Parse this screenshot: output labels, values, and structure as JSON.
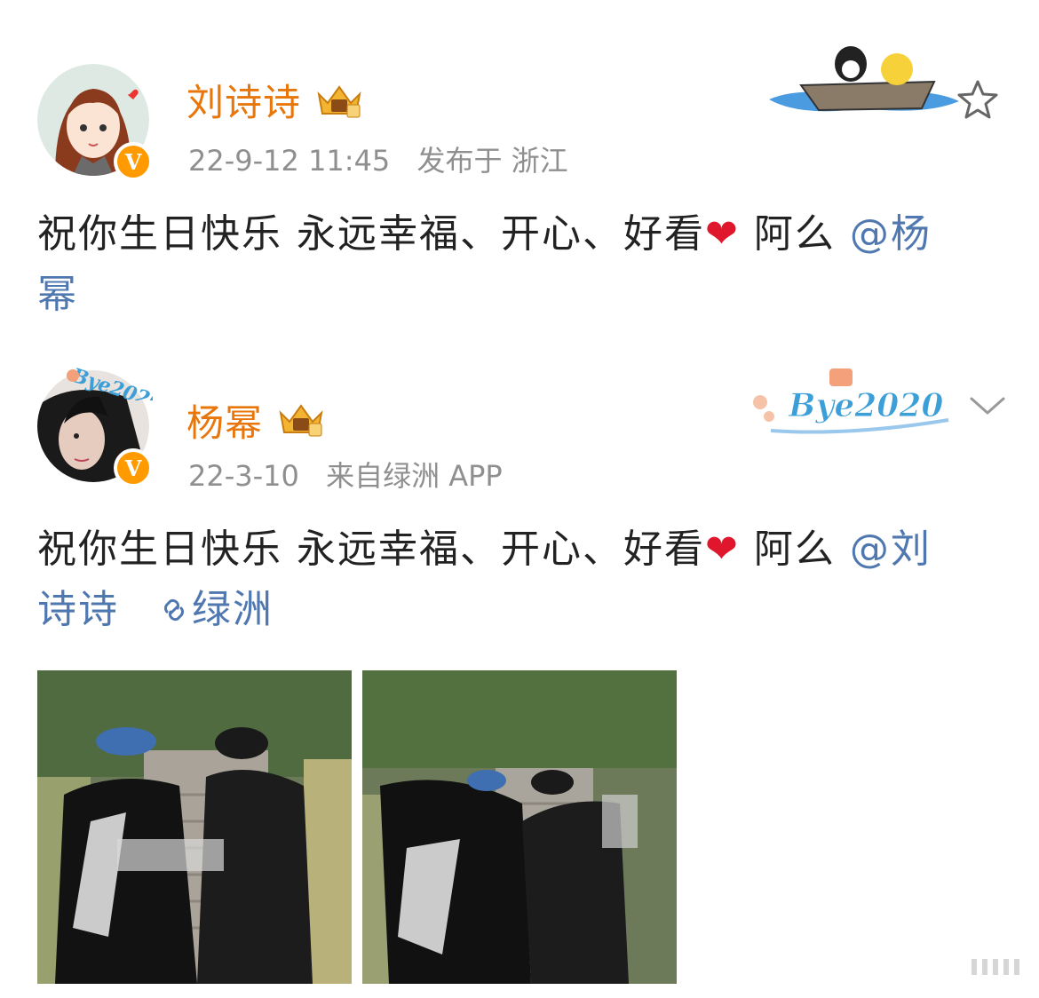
{
  "posts": [
    {
      "username": "刘诗诗",
      "time": "22-9-12 11:45",
      "source": "发布于 浙江",
      "content_text": "祝你生日快乐 永远幸福、开心、好看",
      "heart": "❤",
      "suffix": " 阿么",
      "mention_line1": "@杨",
      "mention_line2": "幂",
      "decoration": "boat-penguin-duck",
      "action_icon": "star-icon"
    },
    {
      "username": "杨幂",
      "time": "22-3-10",
      "source": "来自绿洲 APP",
      "content_text": "祝你生日快乐 永远幸福、开心、好看",
      "heart": "❤",
      "suffix": " 阿么",
      "mention_line1": "@刘",
      "mention_line2": "诗诗",
      "link_icon": "link-icon",
      "link_label": "绿洲",
      "decoration_text": "Bye2020",
      "avatar_text": "Bye2020",
      "action_icon": "chevron-down-icon",
      "photos": [
        "photo-1",
        "photo-2"
      ]
    }
  ],
  "colors": {
    "username": "#e8760a",
    "meta": "#8f8f8f",
    "mention": "#5078b0",
    "heart": "#e0172c",
    "badge": "#ff9a00"
  }
}
